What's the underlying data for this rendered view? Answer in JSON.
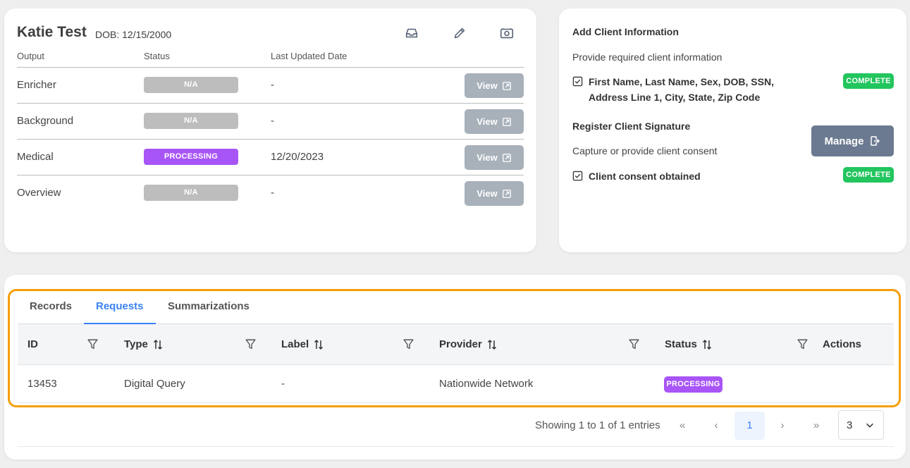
{
  "client": {
    "name": "Katie Test",
    "dob": "DOB: 12/15/2000",
    "columns": {
      "output": "Output",
      "status": "Status",
      "updated": "Last Updated Date"
    },
    "view_label": "View",
    "rows": [
      {
        "output": "Enricher",
        "status": "N/A",
        "date": "-"
      },
      {
        "output": "Background",
        "status": "N/A",
        "date": "-"
      },
      {
        "output": "Medical",
        "status": "PROCESSING",
        "date": "12/20/2023"
      },
      {
        "output": "Overview",
        "status": "N/A",
        "date": "-"
      }
    ],
    "icons": [
      "inbox-icon",
      "pencil-icon",
      "camera-icon"
    ]
  },
  "info": {
    "add_title": "Add Client Information",
    "add_text": "Provide required client information",
    "fields_line1": "First Name, Last Name, Sex, DOB, SSN,",
    "fields_line2": "Address Line 1, City, State, Zip Code",
    "badge_complete": "COMPLETE",
    "sig_title": "Register Client Signature",
    "sig_text": "Capture or provide client consent",
    "consent": "Client consent obtained",
    "manage_label": "Manage"
  },
  "requests": {
    "tabs": [
      "Records",
      "Requests",
      "Summarizations"
    ],
    "active_tab": "Requests",
    "headers": {
      "id": "ID",
      "type": "Type",
      "label": "Label",
      "provider": "Provider",
      "status": "Status",
      "actions": "Actions"
    },
    "row": {
      "id": "13453",
      "type": "Digital Query",
      "label": "-",
      "provider": "Nationwide Network",
      "status": "PROCESSING"
    },
    "pager": {
      "summary": "Showing 1 to 1 of 1 entries",
      "first": "«",
      "prev": "‹",
      "page": "1",
      "next": "›",
      "last": "»",
      "per_page": "3"
    }
  },
  "colors": {
    "accent": "#3b82f6",
    "processing": "#a855f7",
    "complete": "#22c55e",
    "na": "#bdbdbd",
    "highlight": "#f59e0b"
  }
}
